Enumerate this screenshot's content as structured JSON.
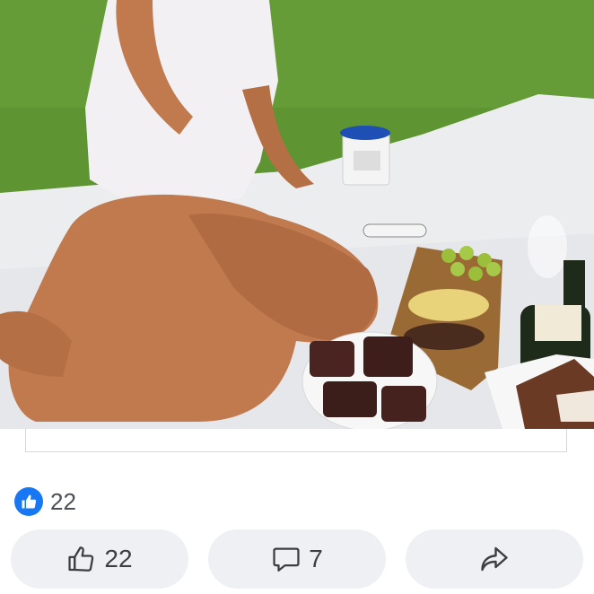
{
  "post": {
    "photo_icon": "picnic-photo",
    "reactions": {
      "icon": "like-icon",
      "count": "22"
    }
  },
  "actions": [
    {
      "name": "like",
      "icon": "thumbs-up-icon",
      "label": "22"
    },
    {
      "name": "comment",
      "icon": "comment-icon",
      "label": "7"
    },
    {
      "name": "share",
      "icon": "share-arrow-icon",
      "label": ""
    }
  ],
  "colors": {
    "like_blue": "#1877f2",
    "button_bg": "#eef0f3",
    "grass": "#5a8c2e"
  }
}
